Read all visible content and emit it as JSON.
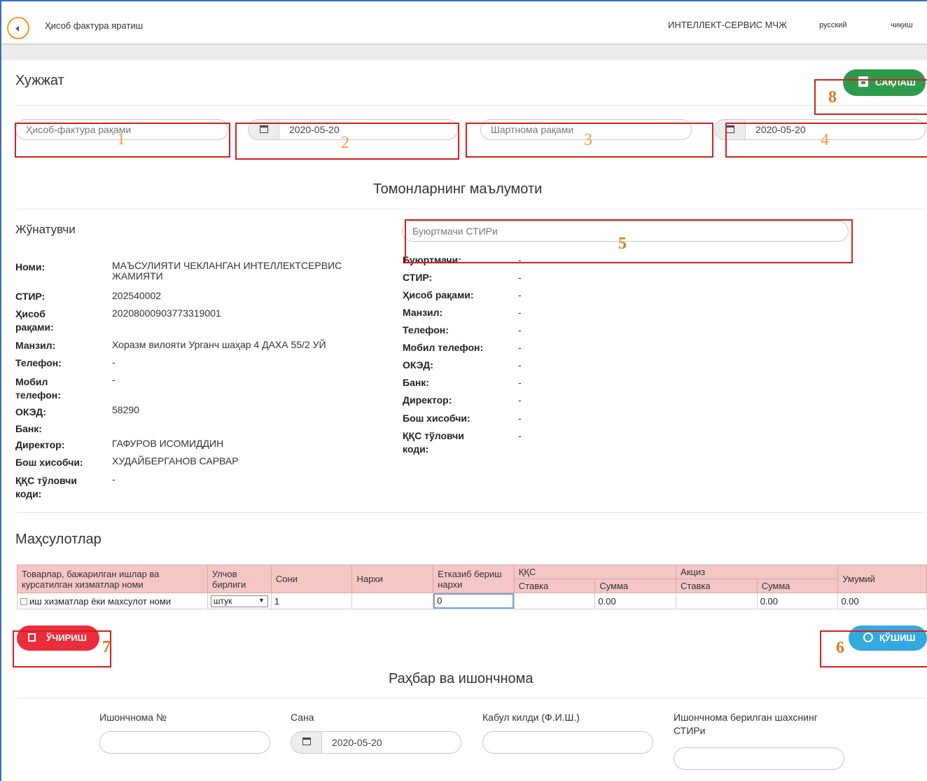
{
  "header": {
    "title": "Ҳисоб фактура яратиш",
    "company": "ИНТЕЛЛЕКТ-СЕРВИС МЧЖ",
    "language": "русский",
    "logout": "чиқиш"
  },
  "document": {
    "title": "Хужжат",
    "save_label": "САҚЛАШ",
    "invoice_number_placeholder": "Ҳисоб-фактура рақами",
    "invoice_date": "2020-05-20",
    "contract_number_placeholder": "Шартнома рақами",
    "contract_date": "2020-05-20"
  },
  "parties": {
    "title": "Томонларнинг маълумоти",
    "sender": {
      "title": "Жўнатувчи",
      "name_label": "Номи:",
      "name": "МАЪСУЛИЯТИ ЧЕКЛАНГАН ИНТЕЛЛЕКТСЕРВИС ЖАМИЯТИ",
      "stir_label": "СТИР:",
      "stir": "202540002",
      "account_label": "Ҳисоб рақами:",
      "account": "20208000903773319001",
      "address_label": "Манзил:",
      "address": "Хоразм вилояти Урганч шаҳар 4 ДАХА 55/2 УЙ",
      "phone_label": "Телефон:",
      "phone": "-",
      "mobile_label": "Мобил телефон:",
      "mobile": "-",
      "oked_label": "ОКЭД:",
      "oked": "58290",
      "bank_label": "Банк:",
      "director_label": "Директор:",
      "director": "ГАФУРОВ ИСОМИДДИН",
      "accountant_label": "Бош хисобчи:",
      "accountant": "ХУДАЙБЕРГАНОВ САРВАР",
      "vat_label": "ҚҚС тўловчи коди:",
      "vat": "-"
    },
    "buyer": {
      "stir_placeholder": "Буюртмачи СТИРи",
      "labels": [
        "Буюртмачи:",
        "СТИР:",
        "Ҳисоб рақами:",
        "Манзил:",
        "Телефон:",
        "Мобил телефон:",
        "ОКЭД:",
        "Банк:",
        "Директор:",
        "Бош хисобчи:",
        "ҚҚС тўловчи коди:"
      ],
      "dash": "-"
    }
  },
  "products": {
    "title": "Маҳсулотлар",
    "columns": {
      "name": "Товарлар, бажарилган ишлар ва курсатилган хизматлар номи",
      "unit": "Улчов бирлиги",
      "qty": "Сони",
      "price": "Нархи",
      "delivery": "Етказиб бериш нархи",
      "vat": "ҚҚС",
      "excise": "Акциз",
      "rate": "Ставка",
      "sum": "Сумма",
      "total": "Умумий"
    },
    "rows": [
      {
        "name": "иш хизматлар ёки махсулот номи",
        "unit": "штук",
        "qty": "1",
        "price": "",
        "delivery": "0",
        "vat_rate": "",
        "vat_sum": "0.00",
        "excise_rate": "",
        "excise_sum": "0.00",
        "total": "0.00"
      }
    ],
    "delete_label": "ЎЧИРИШ",
    "add_label": "ҚЎШИШ"
  },
  "proxy": {
    "title": "Раҳбар ва ишончнома",
    "number_label": "Ишончнома №",
    "date_label": "Сана",
    "date": "2020-05-20",
    "received_label": "Кабул килди (Ф.И.Ш.)",
    "stir_label": "Ишончнома берилган шахснинг СТИРи"
  },
  "annotations": [
    "1",
    "2",
    "3",
    "4",
    "5",
    "6",
    "7",
    "8"
  ],
  "colors": {
    "save": "#2e9b4b",
    "delete": "#ec2d3c",
    "add": "#33a9e0",
    "annotation_box": "#d42020",
    "annotation_number": "#f29a3e",
    "table_header": "#f4c6c6"
  }
}
